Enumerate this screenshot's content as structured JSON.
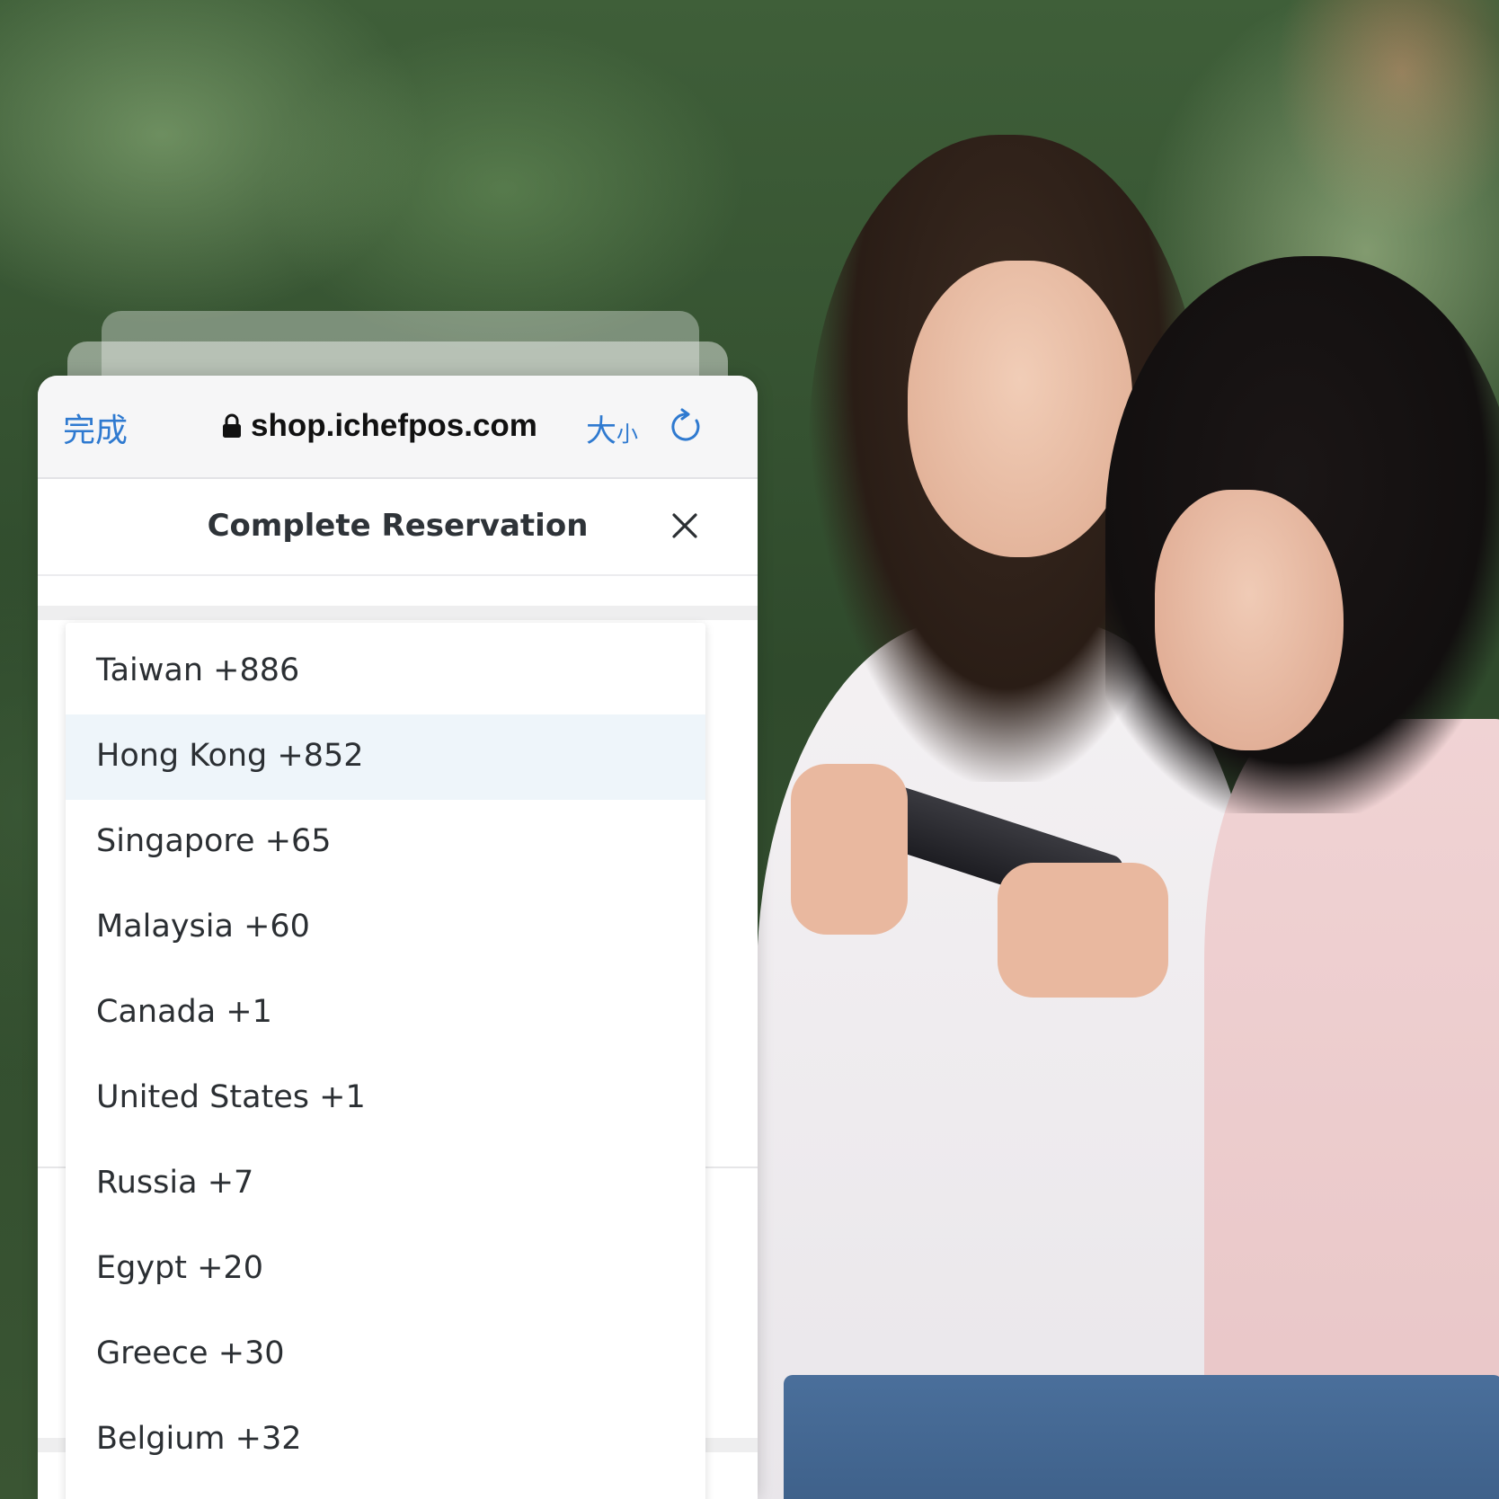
{
  "browser": {
    "done_label": "完成",
    "url": "shop.ichefpos.com",
    "text_size_large": "大",
    "text_size_small": "小"
  },
  "modal": {
    "title": "Complete Reservation"
  },
  "country_codes": {
    "selected_index": 1,
    "items": [
      {
        "label": "Taiwan +886"
      },
      {
        "label": "Hong Kong +852"
      },
      {
        "label": "Singapore +65"
      },
      {
        "label": "Malaysia +60"
      },
      {
        "label": "Canada +1"
      },
      {
        "label": "United States +1"
      },
      {
        "label": "Russia +7"
      },
      {
        "label": "Egypt +20"
      },
      {
        "label": "Greece +30"
      },
      {
        "label": "Belgium +32"
      }
    ]
  },
  "colors": {
    "link_blue": "#2f7ad0",
    "selected_row": "#eef5fa",
    "text_dark": "#2b2f33"
  },
  "icons": {
    "lock": "lock-icon",
    "reload": "reload-icon",
    "close": "close-icon"
  }
}
